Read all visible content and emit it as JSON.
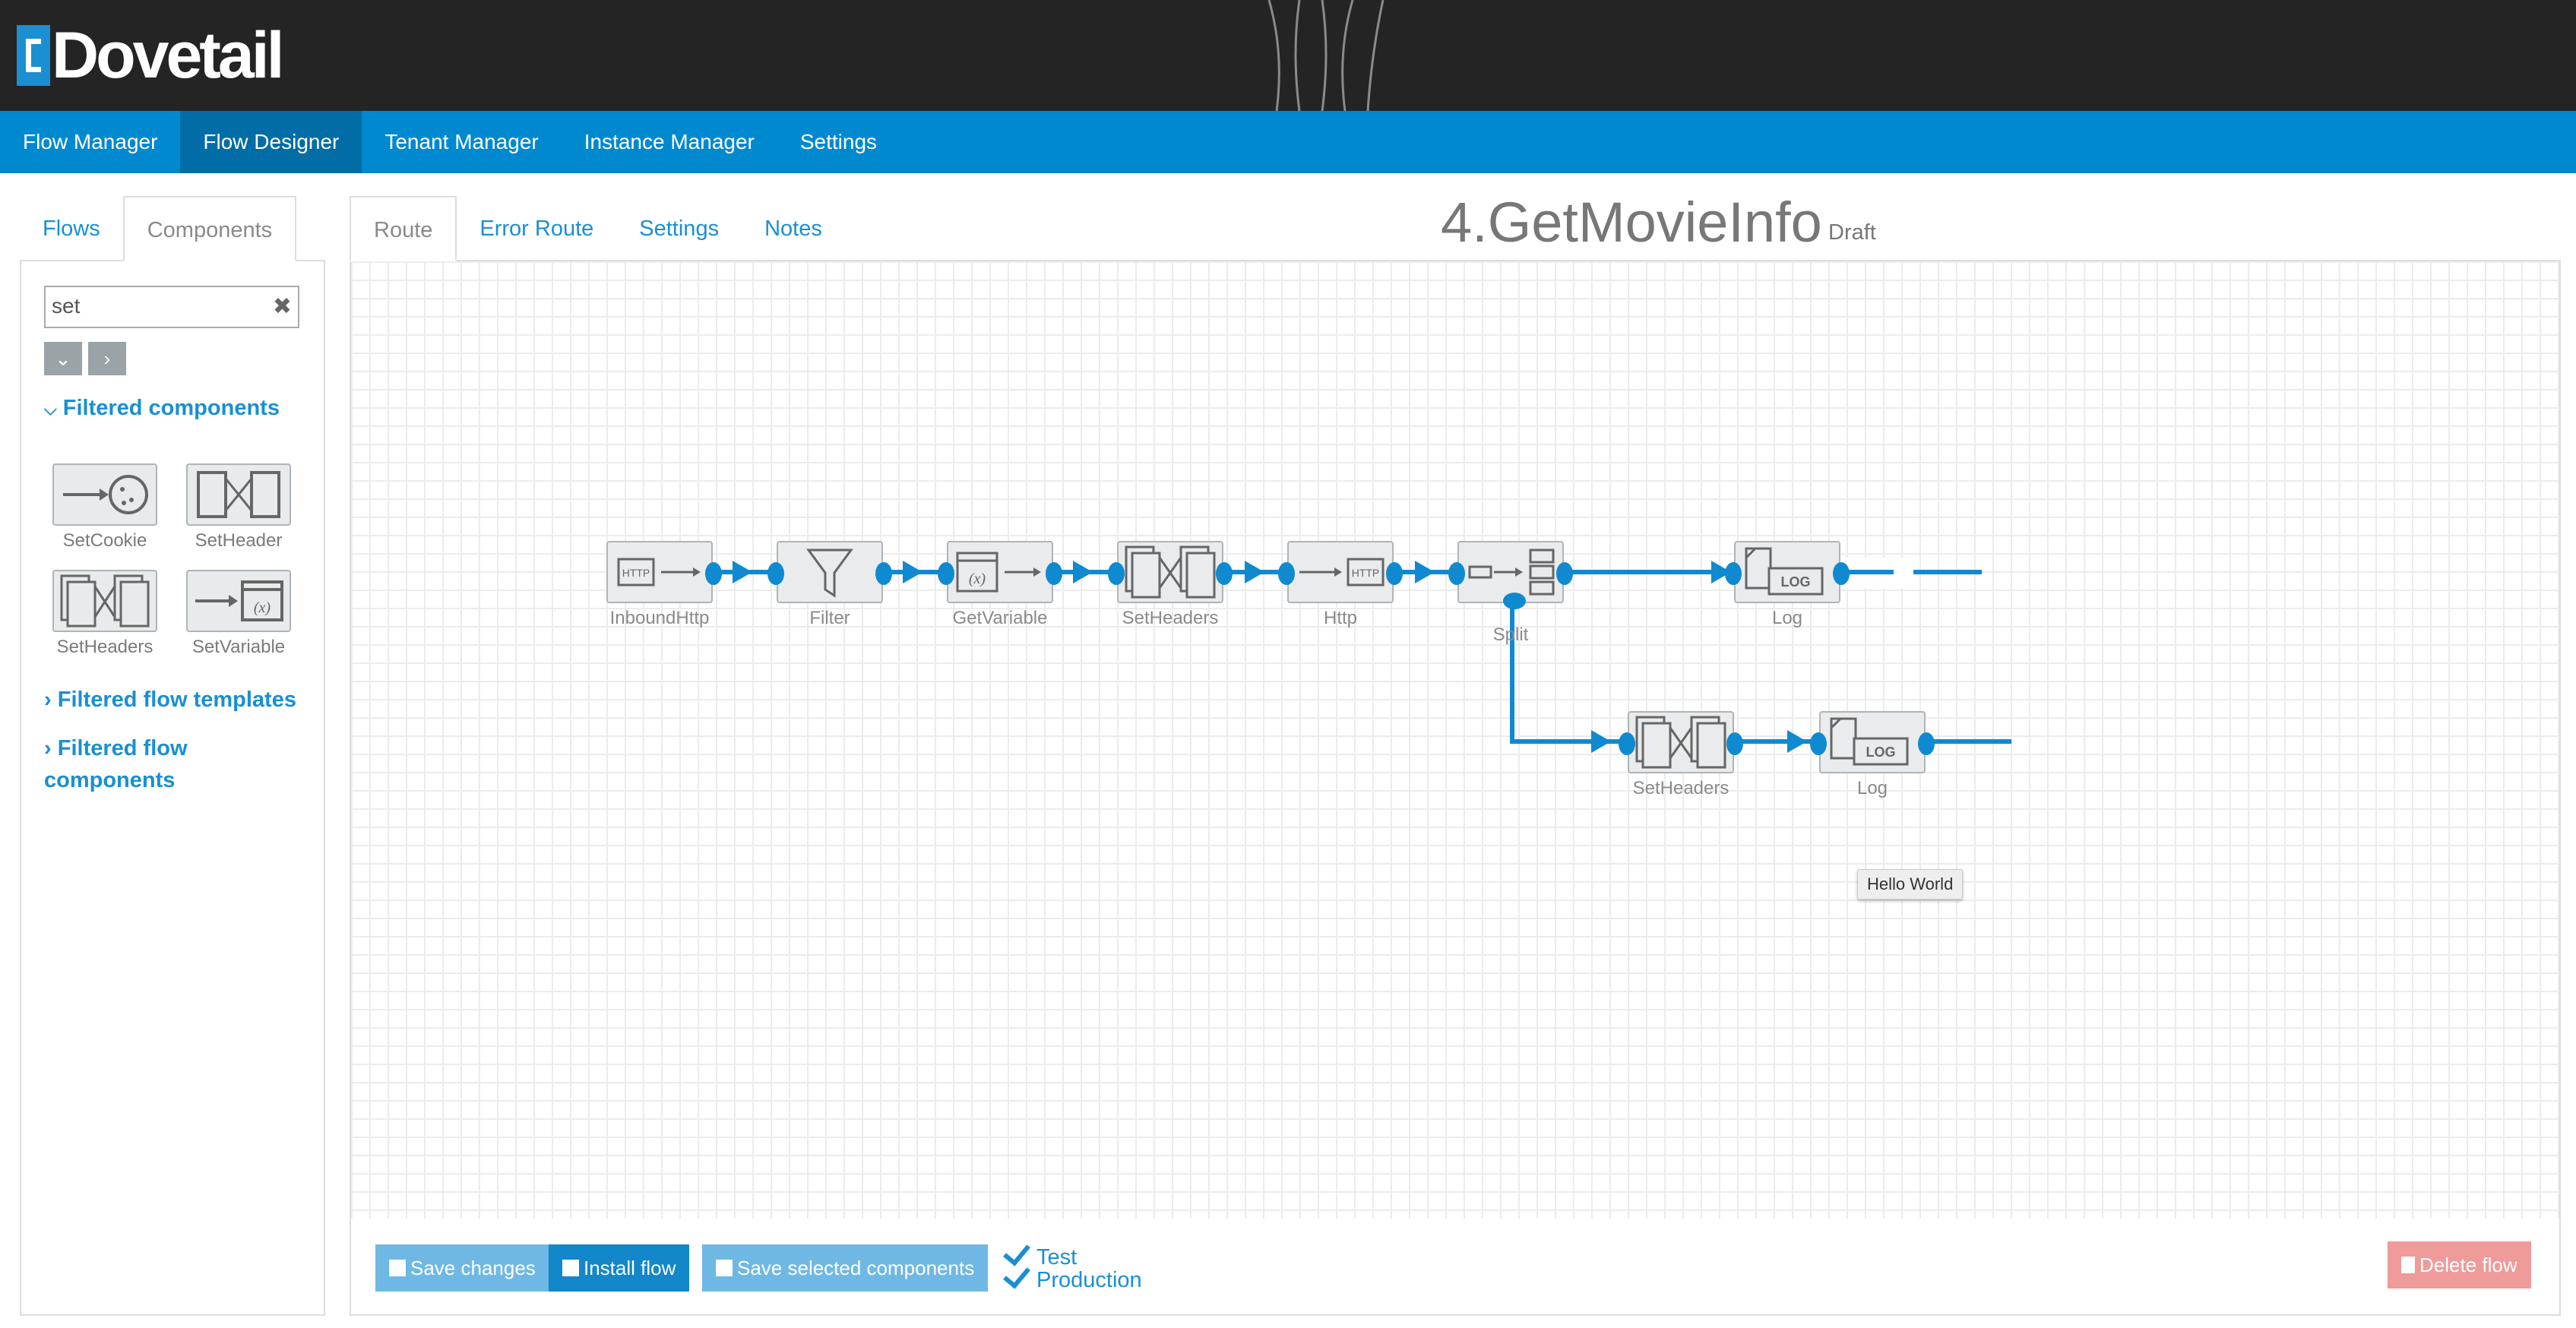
{
  "app": {
    "name": "Dovetail"
  },
  "nav": {
    "items": [
      "Flow Manager",
      "Flow Designer",
      "Tenant Manager",
      "Instance Manager",
      "Settings"
    ],
    "active": "Flow Designer"
  },
  "left_panel": {
    "tabs": [
      "Flows",
      "Components"
    ],
    "active_tab": "Components",
    "search": {
      "value": "set",
      "placeholder": ""
    },
    "sections": {
      "filtered_components": "Filtered components",
      "filtered_flow_templates": "Filtered flow templates",
      "filtered_flow_components_line1": "Filtered flow",
      "filtered_flow_components_line2": "components"
    },
    "components": [
      {
        "label": "SetCookie",
        "icon": "set-cookie-icon"
      },
      {
        "label": "SetHeader",
        "icon": "set-header-icon"
      },
      {
        "label": "SetHeaders",
        "icon": "set-headers-icon"
      },
      {
        "label": "SetVariable",
        "icon": "set-variable-icon"
      }
    ]
  },
  "main": {
    "tabs": [
      "Route",
      "Error Route",
      "Settings",
      "Notes"
    ],
    "active_tab": "Route",
    "flow_title": "4.GetMovieInfo",
    "flow_status": "Draft",
    "nodes": [
      {
        "label": "InboundHttp",
        "icon": "inbound-http-icon"
      },
      {
        "label": "Filter",
        "icon": "filter-icon"
      },
      {
        "label": "GetVariable",
        "icon": "get-variable-icon"
      },
      {
        "label": "SetHeaders",
        "icon": "set-headers-icon"
      },
      {
        "label": "Http",
        "icon": "http-icon"
      },
      {
        "label": "Split",
        "icon": "split-icon"
      },
      {
        "label": "Log",
        "icon": "log-icon"
      },
      {
        "label": "SetHeaders",
        "icon": "set-headers-icon"
      },
      {
        "label": "Log",
        "icon": "log-icon"
      }
    ],
    "tooltip": "Hello World",
    "icon_text": {
      "http": "HTTP",
      "log": "LOG",
      "x": "(x)"
    }
  },
  "footer": {
    "save_changes": "Save changes",
    "install_flow": "Install flow",
    "save_selected": "Save selected components",
    "env_test": "Test",
    "env_production": "Production",
    "delete_flow": "Delete flow"
  },
  "colors": {
    "header_bg": "#242424",
    "nav_bg": "#0089cf",
    "nav_active": "#006da6",
    "accent": "#1a8fd1",
    "wire": "#0f8ad0",
    "danger": "#ee9b9a"
  }
}
